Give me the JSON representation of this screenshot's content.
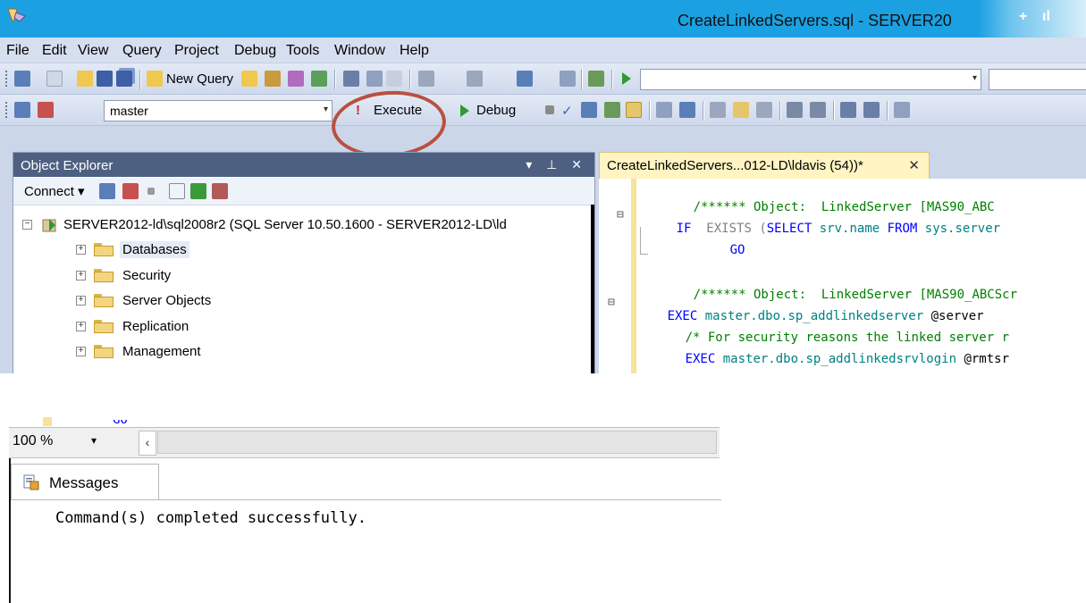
{
  "window": {
    "title": "CreateLinkedServers.sql - SERVER20",
    "tb_glyph1": "+",
    "tb_glyph2": "ıl"
  },
  "menu": [
    "File",
    "Edit",
    "View",
    "Query",
    "Project",
    "Debug",
    "Tools",
    "Window",
    "Help"
  ],
  "toolbar1": {
    "new_query": "New Query"
  },
  "toolbar2": {
    "database": "master",
    "execute": "Execute",
    "debug": "Debug"
  },
  "object_explorer": {
    "title": "Object Explorer",
    "header_glyphs": "▾ ⊥ ✕",
    "connect": "Connect",
    "server": "SERVER2012-ld\\sql2008r2 (SQL Server 10.50.1600 - SERVER2012-LD\\ld",
    "folders": [
      "Databases",
      "Security",
      "Server Objects",
      "Replication",
      "Management"
    ]
  },
  "editor": {
    "tab_label": "CreateLinkedServers...012-LD\\ldavis (54))*",
    "tab_close": "✕",
    "lines": [
      {
        "comment": "/****** Object:  LinkedServer [MAS90_ABC"
      },
      {
        "kw1": "IF",
        "kw2": "EXISTS",
        "paren": "(",
        "kw3": "SELECT",
        "txt1": " srv.name ",
        "kw4": "FROM",
        "txt2": " sys.server"
      },
      {
        "kw": "GO"
      },
      {
        "comment": "/****** Object:  LinkedServer [MAS90_ABCScr"
      },
      {
        "kw": "EXEC",
        "obj": " master.dbo.sp_addlinkedserver",
        "var": " @server"
      },
      {
        "comment": "/* For security reasons the linked server r"
      },
      {
        "kw": "EXEC",
        "obj": " master.dbo.sp_addlinkedsrvlogin",
        "var": " @rmtsr"
      }
    ],
    "fold_minus": "⊟",
    "frag_go": "GO"
  },
  "results": {
    "zoom": "100 %",
    "zoom_arrow": "▾",
    "scroll_left": "‹",
    "messages_tab": "Messages",
    "message": "Command(s) completed successfully."
  },
  "colors": {
    "title_bar": "#1ba1e2",
    "highlight_circle": "#b95040",
    "oe_header": "#4d6082",
    "editor_tab": "#fff4c2"
  }
}
